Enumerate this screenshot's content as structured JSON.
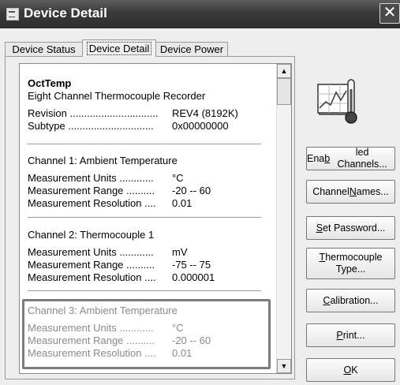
{
  "window": {
    "title": "Device Detail",
    "close_glyph": "✕"
  },
  "tabs": [
    {
      "label": "Device Status"
    },
    {
      "label": "Device Detail"
    },
    {
      "label": "Device Power"
    }
  ],
  "device": {
    "name": "OctTemp",
    "description": "Eight Channel Thermocouple Recorder",
    "revision_label": "Revision ...............................",
    "revision_value": "REV4 (8192K)",
    "subtype_label": "Subtype ..............................",
    "subtype_value": "0x00000000"
  },
  "channels": [
    {
      "title": "Channel 1: Ambient Temperature",
      "units_label": "Measurement Units ............",
      "units": "°C",
      "range_label": "Measurement Range ..........",
      "range": "-20 -- 60",
      "res_label": "Measurement Resolution ....",
      "resolution": "0.01"
    },
    {
      "title": "Channel 2: Thermocouple  1",
      "units_label": "Measurement Units ............",
      "units": "mV",
      "range_label": "Measurement Range ..........",
      "range": "-75 -- 75",
      "res_label": "Measurement Resolution ....",
      "resolution": "0.000001"
    },
    {
      "title": "Channel 3: Ambient Temperature",
      "units_label": "Measurement Units ............",
      "units": "°C",
      "range_label": "Measurement Range ..........",
      "range": "-20 -- 60",
      "res_label": "Measurement Resolution ....",
      "resolution": "0.01"
    }
  ],
  "buttons": {
    "enabled_channels": {
      "pre": "Ena",
      "key": "b",
      "post": "led Channels..."
    },
    "channel_names": {
      "pre": "Channel ",
      "key": "N",
      "post": "ames..."
    },
    "set_password": {
      "pre": "",
      "key": "S",
      "post": "et Password..."
    },
    "thermocouple_type": {
      "pre": "",
      "key": "T",
      "post": "hermocouple",
      "line2": "Type..."
    },
    "calibration": {
      "pre": "",
      "key": "C",
      "post": "alibration..."
    },
    "print": {
      "pre": "",
      "key": "P",
      "post": "rint..."
    },
    "ok": {
      "pre": "",
      "key": "O",
      "post": "K"
    }
  },
  "icons": {
    "device": "chart-thermometer-icon",
    "scroll_up": "▲",
    "scroll_down": "▼"
  }
}
